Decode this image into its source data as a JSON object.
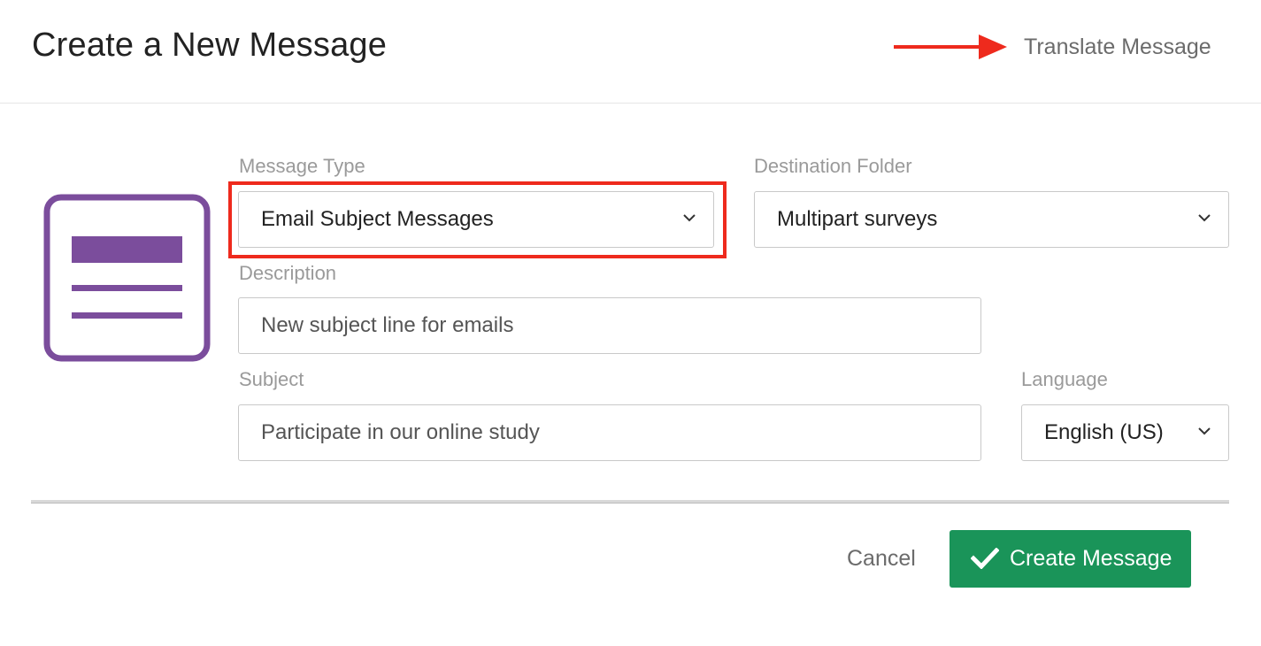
{
  "header": {
    "title": "Create a New Message",
    "translate_link": "Translate Message"
  },
  "form": {
    "message_type": {
      "label": "Message Type",
      "value": "Email Subject Messages"
    },
    "destination_folder": {
      "label": "Destination Folder",
      "value": "Multipart surveys"
    },
    "description": {
      "label": "Description",
      "value": "New subject line for emails"
    },
    "subject": {
      "label": "Subject",
      "value": "Participate in our online study"
    },
    "language": {
      "label": "Language",
      "value": "English (US)"
    }
  },
  "footer": {
    "cancel_label": "Cancel",
    "create_label": "Create Message"
  },
  "colors": {
    "accent_purple": "#7b4d9c",
    "annotation_red": "#ee2a1d",
    "primary_green": "#1a9459"
  },
  "icons": [
    "message-document-icon",
    "chevron-down-icon",
    "checkmark-icon",
    "red-arrow-annotation"
  ]
}
